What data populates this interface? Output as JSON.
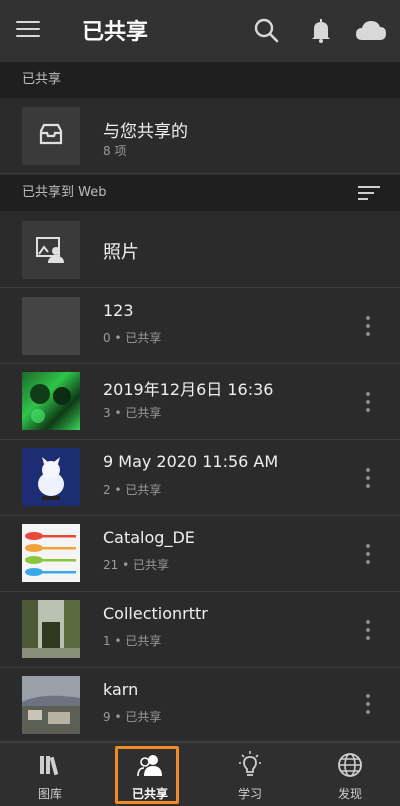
{
  "header": {
    "title": "已共享",
    "menu_icon": "hamburger-menu-icon",
    "search_icon": "search-icon",
    "bell_icon": "bell-icon",
    "cloud_icon": "cloud-icon"
  },
  "shared_with_me_section": {
    "label": "已共享",
    "item": {
      "name": "与您共享的",
      "meta": "8 项",
      "icon": "inbox-icon"
    }
  },
  "shared_to_web_section": {
    "label": "已共享到 Web",
    "sort_icon": "sort-icon"
  },
  "photos_row": {
    "name": "照片",
    "icon": "photo-person-icon"
  },
  "albums": [
    {
      "name": "123",
      "count": "0",
      "status": "已共享"
    },
    {
      "name": "2019年12月6日 16:36",
      "count": "3",
      "status": "已共享"
    },
    {
      "name": "9 May 2020 11:56 AM",
      "count": "2",
      "status": "已共享"
    },
    {
      "name": "Catalog_DE",
      "count": "21",
      "status": "已共享"
    },
    {
      "name": "Collectionrttr",
      "count": "1",
      "status": "已共享"
    },
    {
      "name": "karn",
      "count": "9",
      "status": "已共享"
    }
  ],
  "meta_separator": "•",
  "tabs": [
    {
      "label": "图库",
      "icon": "library-icon"
    },
    {
      "label": "已共享",
      "icon": "people-icon",
      "active": true
    },
    {
      "label": "学习",
      "icon": "lightbulb-icon"
    },
    {
      "label": "发现",
      "icon": "globe-icon"
    }
  ],
  "colors": {
    "accent_highlight": "#f08a2c"
  }
}
